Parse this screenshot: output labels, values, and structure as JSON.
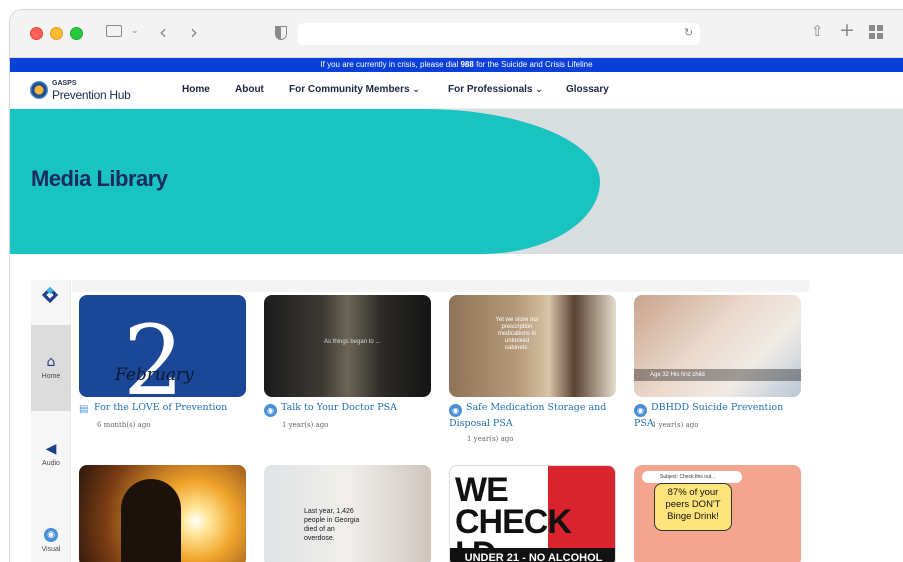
{
  "browser": {
    "sidebar_icon": "sidebar-icon",
    "back_icon": "‹",
    "forward_icon": "›",
    "share_icon": "share-icon",
    "new_tab_icon": "+",
    "tabs_icon": "tabs-overview-icon"
  },
  "crisis_banner": {
    "before": "If you are currently in crisis, please dial",
    "number": "988",
    "after": "for the Suicide and Crisis Lifeline"
  },
  "site": {
    "logo_small": "GASPS",
    "logo_big": "Prevention Hub"
  },
  "nav": {
    "home": "Home",
    "about": "About",
    "community": "For Community Members",
    "professionals": "For Professionals",
    "glossary": "Glossary"
  },
  "hero": {
    "title": "Media Library"
  },
  "sidebar": {
    "home": "Home",
    "audio": "Audio",
    "visual": "Visual"
  },
  "cards": [
    {
      "title": "For the LOVE of Prevention",
      "age": "6 month(s) ago",
      "type": "document",
      "thumb_text": "February"
    },
    {
      "title": "Talk to Your Doctor PSA",
      "age": "1 year(s) ago",
      "type": "visual",
      "thumb_text": "As things began to ..."
    },
    {
      "title": "Safe Medication Storage and Disposal PSA",
      "age": "1 year(s) ago",
      "type": "visual",
      "thumb_text": "Yet we store our prescription medications in unlocked cabinets."
    },
    {
      "title": "DBHDD Suicide Prevention PSA",
      "age": "1 year(s) ago",
      "type": "visual",
      "thumb_text": "Age 32  His first child"
    },
    {
      "title": "",
      "age": "",
      "type": "visual",
      "thumb_text": ""
    },
    {
      "title": "",
      "age": "",
      "type": "visual",
      "thumb_text": "Last year, 1,426 people in Georgia died of an overdose."
    },
    {
      "title": "",
      "age": "",
      "type": "visual",
      "thumb_text": "WE CHECK I.D.",
      "thumb_sub": "UNDER 21 - NO ALCOHOL"
    },
    {
      "title": "",
      "age": "",
      "type": "visual",
      "thumb_text": "87% of your peers DON'T Binge Drink!",
      "thumb_sub": "Subject: Check this out..."
    }
  ]
}
